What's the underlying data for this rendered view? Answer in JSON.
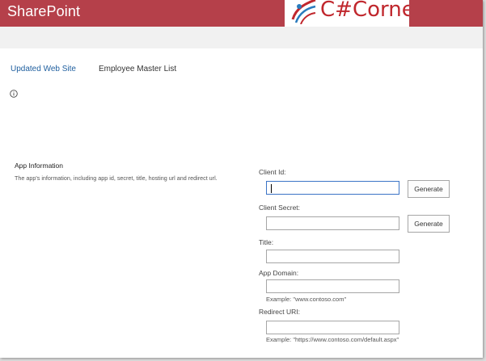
{
  "header": {
    "brand": "SharePoint",
    "logo_text": "C#Corner"
  },
  "nav": {
    "items": [
      {
        "label": "Updated Web Site",
        "active": true
      },
      {
        "label": "Employee Master List",
        "active": false
      }
    ]
  },
  "icons": {
    "info": "info-icon"
  },
  "app_info": {
    "title": "App Information",
    "description": "The app's information, including app id, secret, title, hosting url and redirect url."
  },
  "form": {
    "client_id": {
      "label": "Client Id:",
      "value": "",
      "placeholder": ""
    },
    "client_secret": {
      "label": "Client Secret:",
      "value": "",
      "placeholder": ""
    },
    "title": {
      "label": "Title:",
      "value": "",
      "placeholder": ""
    },
    "app_domain": {
      "label": "App Domain:",
      "value": "",
      "placeholder": "",
      "example": "Example: \"www.contoso.com\""
    },
    "redirect_uri": {
      "label": "Redirect URI:",
      "value": "",
      "placeholder": "",
      "example": "Example: \"https://www.contoso.com/default.aspx\""
    },
    "generate_label": "Generate"
  },
  "colors": {
    "suite_bar": "#b5404a",
    "accent_link": "#1f5f9f",
    "focus_border": "#3b74c6"
  }
}
